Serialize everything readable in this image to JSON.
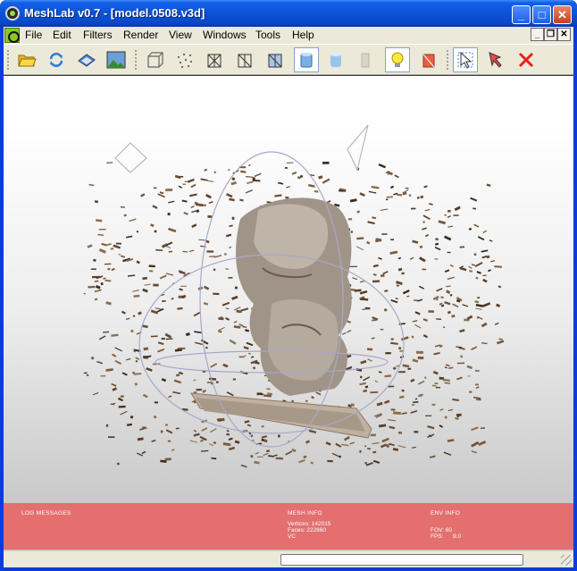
{
  "window": {
    "title": "MeshLab v0.7 - [model.0508.v3d]",
    "controls": {
      "minimize": "_",
      "maximize": "□",
      "close": "✕"
    }
  },
  "menubar": {
    "items": [
      {
        "label": "File",
        "name": "menu-file"
      },
      {
        "label": "Edit",
        "name": "menu-edit"
      },
      {
        "label": "Filters",
        "name": "menu-filters"
      },
      {
        "label": "Render",
        "name": "menu-render"
      },
      {
        "label": "View",
        "name": "menu-view"
      },
      {
        "label": "Windows",
        "name": "menu-windows"
      },
      {
        "label": "Tools",
        "name": "menu-tools"
      },
      {
        "label": "Help",
        "name": "menu-help"
      }
    ],
    "mdi_controls": {
      "minimize": "_",
      "restore": "❐",
      "close": "✕"
    }
  },
  "toolbar": {
    "tools": [
      {
        "icon": "open-folder-icon",
        "active": false
      },
      {
        "icon": "reload-icon",
        "active": false
      },
      {
        "icon": "save-icon",
        "active": false
      },
      {
        "icon": "snapshot-icon",
        "active": false
      },
      {
        "icon": "bounding-box-icon",
        "active": false
      },
      {
        "icon": "points-icon",
        "active": false
      },
      {
        "icon": "wireframe-icon",
        "active": false
      },
      {
        "icon": "hidden-lines-icon",
        "active": false
      },
      {
        "icon": "flat-lines-icon",
        "active": false
      },
      {
        "icon": "flat-shading-icon",
        "active": true
      },
      {
        "icon": "smooth-shading-icon",
        "active": false
      },
      {
        "icon": "texture-icon",
        "active": false
      },
      {
        "icon": "light-icon",
        "active": true
      },
      {
        "icon": "backface-culling-icon",
        "active": false
      },
      {
        "icon": "select-faces-icon",
        "active": true
      },
      {
        "icon": "select-vertices-icon",
        "active": false
      },
      {
        "icon": "delete-selection-icon",
        "active": false
      }
    ]
  },
  "colors": {
    "info_bar": "#e36f6f",
    "title_bar": "#0a48c8",
    "chrome": "#ece9d8"
  },
  "info": {
    "log_header": "LOG MESSAGES",
    "mesh_header": "MESH INFO",
    "vertices": "Vertices: 142015",
    "faces": "Faces: 222860",
    "mode": "VC",
    "env_header": "ENV INFO",
    "fov": "FOV: 60",
    "fps_label": "FPS:",
    "fps_value": "9.0"
  }
}
